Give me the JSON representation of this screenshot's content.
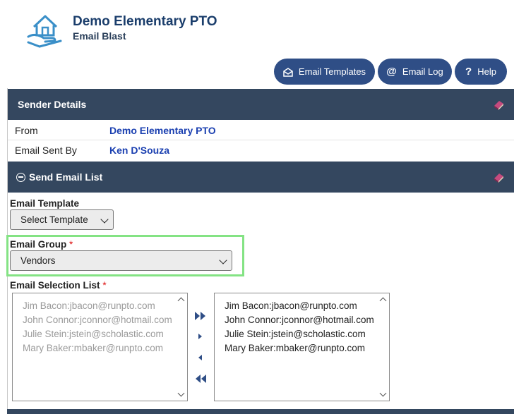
{
  "header": {
    "org_name": "Demo Elementary PTO",
    "page_name": "Email Blast",
    "logo_icon": "house-hand-icon"
  },
  "toolbar": {
    "templates_label": "Email Templates",
    "log_label": "Email Log",
    "help_label": "Help",
    "accent": "#2f4e86"
  },
  "sender": {
    "title": "Sender Details",
    "from_label": "From",
    "from_value": "Demo Elementary PTO",
    "sent_by_label": "Email Sent By",
    "sent_by_value": "Ken D'Souza"
  },
  "send_list": {
    "title": "Send Email List",
    "template_label": "Email Template",
    "template_value": "Select Template",
    "group_label": "Email Group",
    "group_required": "*",
    "group_value": "Vendors",
    "selection_label": "Email Selection List",
    "selection_required": "*",
    "available": [
      "Jim Bacon:jbacon@runpto.com",
      "John Connor:jconnor@hotmail.com",
      "Julie Stein:jstein@scholastic.com",
      "Mary Baker:mbaker@runpto.com"
    ],
    "selected": [
      "Jim Bacon:jbacon@runpto.com",
      "John Connor:jconnor@hotmail.com",
      "Julie Stein:jstein@scholastic.com",
      "Mary Baker:mbaker@runpto.com"
    ]
  },
  "colors": {
    "section_bar": "#34475f",
    "link_value": "#1a3fb0",
    "highlight": "#84e384"
  }
}
